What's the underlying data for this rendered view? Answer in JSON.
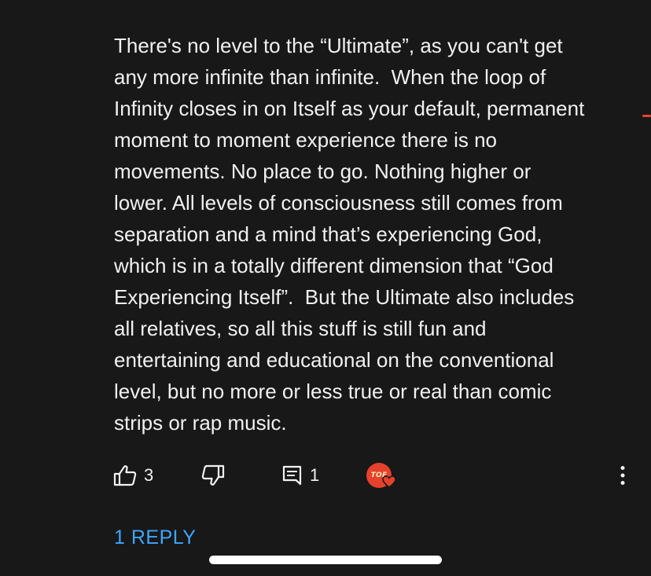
{
  "comment": {
    "lines": [
      "There's no level to the “Ultimate”, as you can't get",
      "any more infinite than infinite.  When the loop of",
      "Infinity closes in on Itself as your default, permanent",
      "moment to moment experience there is no",
      "movements. No place to go. Nothing higher or",
      "lower. All levels of consciousness still comes from",
      "separation and a mind that’s experiencing God,",
      "which is in a totally different dimension that “God",
      "Experiencing Itself”.  But the Ultimate also includes",
      "all relatives, so all this stuff is still fun and",
      "entertaining and educational on the conventional",
      "level, but no more or less true or real than comic",
      "strips or rap music."
    ]
  },
  "actions": {
    "like_count": "3",
    "reply_count": "1",
    "creator_avatar_text": "TOE",
    "icons": {
      "like": "thumbs-up-icon",
      "dislike": "thumbs-down-icon",
      "reply": "reply-comment-icon",
      "heart": "heart-icon",
      "more": "more-vertical-icon"
    }
  },
  "replies": {
    "label": "1 REPLY"
  },
  "colors": {
    "background": "#181818",
    "text": "#f1f1f1",
    "link": "#3ea6ff",
    "heart": "#e5412d"
  }
}
